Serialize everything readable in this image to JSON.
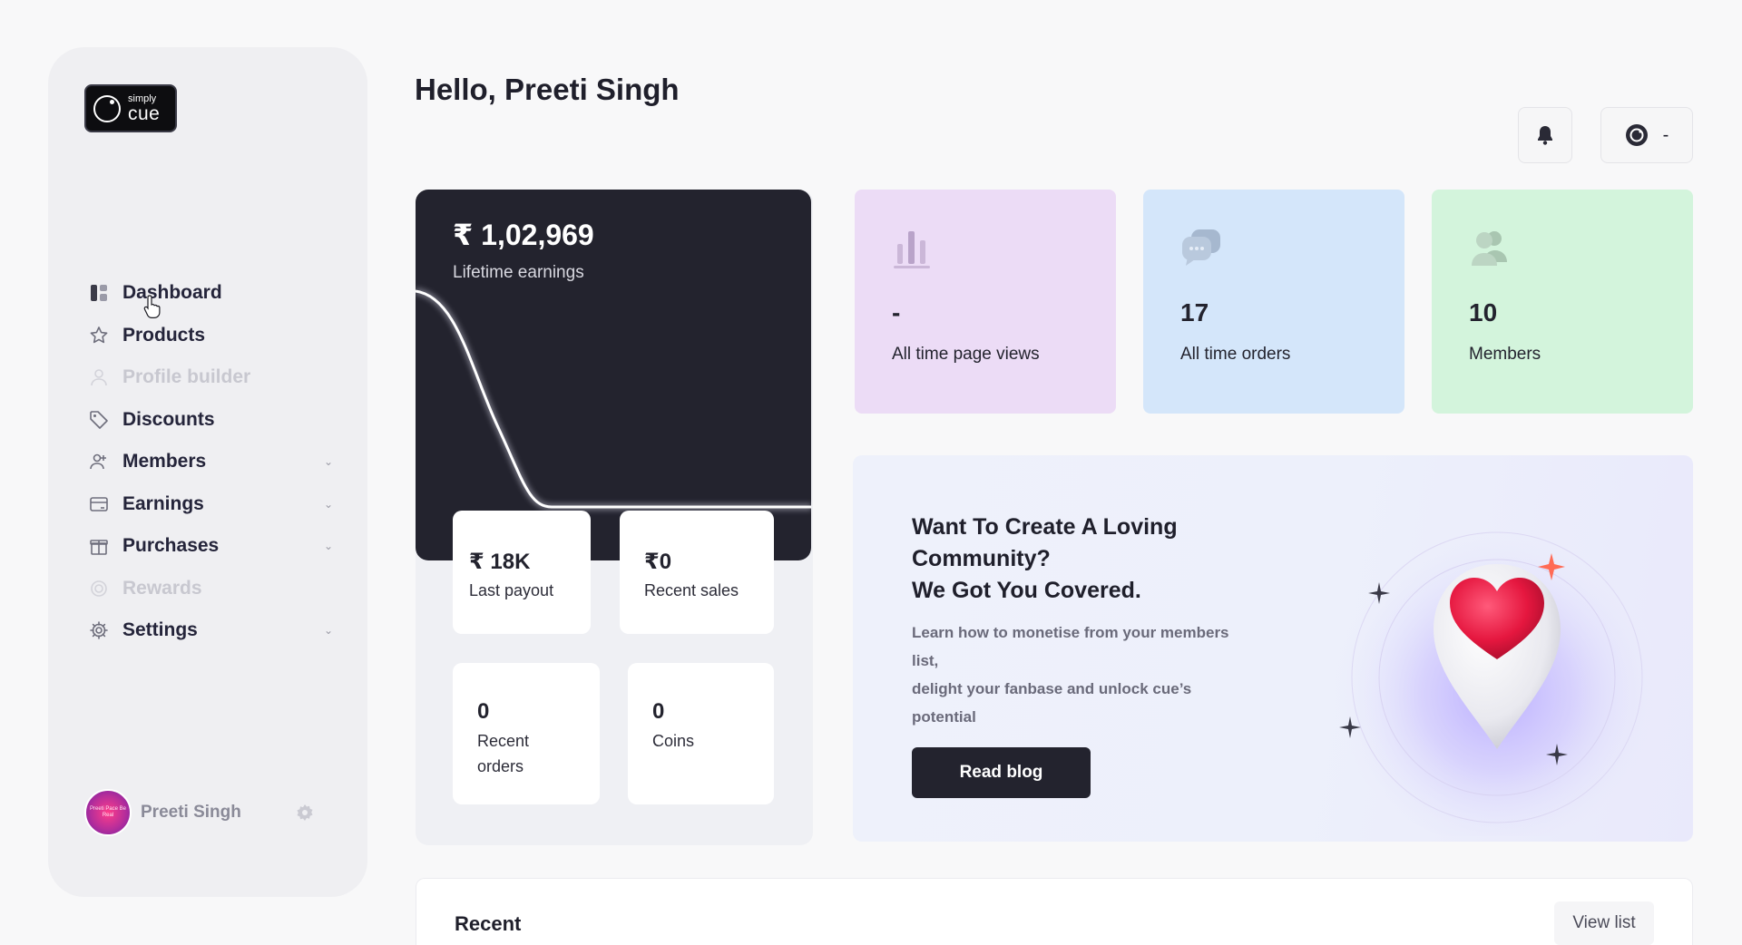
{
  "brand": {
    "logo_small": "simply",
    "logo_big": "cue"
  },
  "sidebar": {
    "items": [
      {
        "label": "Dashboard",
        "icon": "dashboard-icon",
        "disabled": false,
        "has_children": false
      },
      {
        "label": "Products",
        "icon": "star-icon",
        "disabled": false,
        "has_children": false
      },
      {
        "label": "Profile builder",
        "icon": "user-icon",
        "disabled": true,
        "has_children": false
      },
      {
        "label": "Discounts",
        "icon": "tag-icon",
        "disabled": false,
        "has_children": false
      },
      {
        "label": "Members",
        "icon": "members-icon",
        "disabled": false,
        "has_children": true
      },
      {
        "label": "Earnings",
        "icon": "card-icon",
        "disabled": false,
        "has_children": true
      },
      {
        "label": "Purchases",
        "icon": "gift-icon",
        "disabled": false,
        "has_children": true
      },
      {
        "label": "Rewards",
        "icon": "coin-icon",
        "disabled": true,
        "has_children": false
      },
      {
        "label": "Settings",
        "icon": "gear-icon",
        "disabled": false,
        "has_children": true
      }
    ],
    "profile": {
      "name": "Preeti Singh",
      "avatar_text": "Preeti Pace Be Real"
    }
  },
  "header": {
    "greeting": "Hello, Preeti Singh",
    "account_label": "-"
  },
  "earnings": {
    "amount": "₹ 1,02,969",
    "label": "Lifetime earnings",
    "last_payout": {
      "value": "₹ 18K",
      "label": "Last payout"
    },
    "recent_sales": {
      "value": "₹0",
      "label": "Recent sales"
    },
    "recent_orders": {
      "value": "0",
      "label_line1": "Recent",
      "label_line2": "orders"
    },
    "coins": {
      "value": "0",
      "label": "Coins"
    }
  },
  "stats": [
    {
      "value": "-",
      "label": "All time page views",
      "color": "#ecdcf6",
      "icon": "bar-chart-icon"
    },
    {
      "value": "17",
      "label": "All time orders",
      "color": "#d4e6fa",
      "icon": "chat-bubbles-icon"
    },
    {
      "value": "10",
      "label": "Members",
      "color": "#d3f4dc",
      "icon": "users-icon"
    }
  ],
  "promo": {
    "title_line1": "Want To Create A Loving",
    "title_line2": "Community?",
    "title_line3": "We Got You Covered.",
    "text_line1": "Learn how to monetise from your members",
    "text_line2": "list,",
    "text_line3": "delight your fanbase and unlock cue’s",
    "text_line4": "potential",
    "button": "Read blog"
  },
  "recent": {
    "title": "Recent",
    "button": "View list"
  }
}
